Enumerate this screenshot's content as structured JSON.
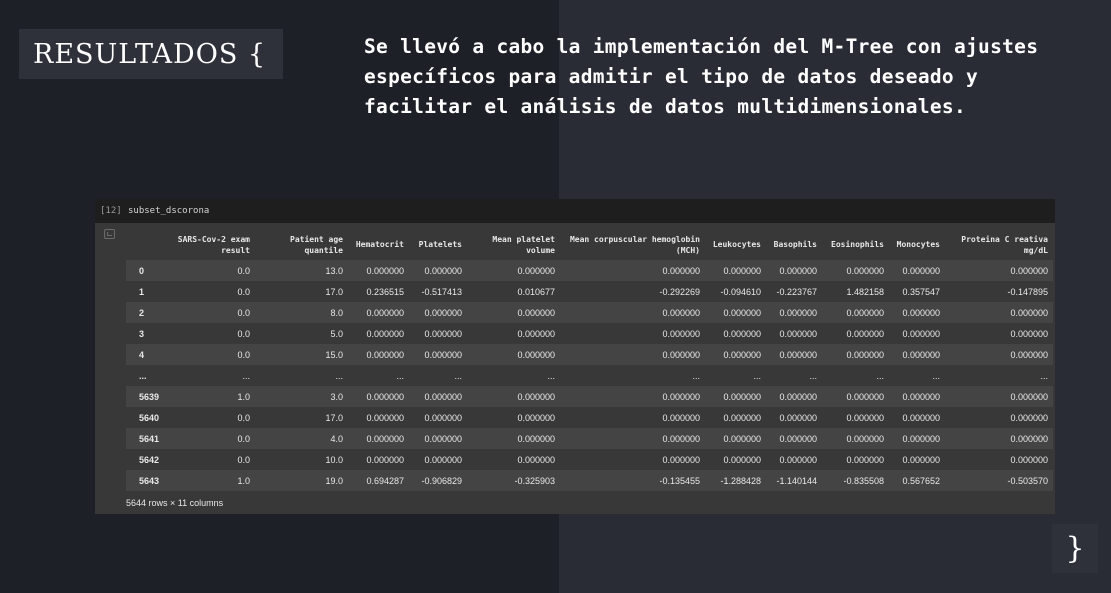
{
  "slide": {
    "title": "RESULTADOS {",
    "description": "Se llevó a cabo la implementación del M-Tree con ajustes específicos para admitir el tipo de datos deseado y facilitar el análisis de datos multidimensionales.",
    "closing_brace": "}"
  },
  "notebook": {
    "execution_count": "[12]",
    "code": "subset_dscorona",
    "columns": [
      "",
      "SARS-Cov-2 exam result",
      "Patient age quantile",
      "Hematocrit",
      "Platelets",
      "Mean platelet volume",
      "Mean corpuscular hemoglobin (MCH)",
      "Leukocytes",
      "Basophils",
      "Eosinophils",
      "Monocytes",
      "Proteina C reativa mg/dL"
    ],
    "rows": [
      [
        "0",
        "0.0",
        "13.0",
        "0.000000",
        "0.000000",
        "0.000000",
        "0.000000",
        "0.000000",
        "0.000000",
        "0.000000",
        "0.000000",
        "0.000000"
      ],
      [
        "1",
        "0.0",
        "17.0",
        "0.236515",
        "-0.517413",
        "0.010677",
        "-0.292269",
        "-0.094610",
        "-0.223767",
        "1.482158",
        "0.357547",
        "-0.147895"
      ],
      [
        "2",
        "0.0",
        "8.0",
        "0.000000",
        "0.000000",
        "0.000000",
        "0.000000",
        "0.000000",
        "0.000000",
        "0.000000",
        "0.000000",
        "0.000000"
      ],
      [
        "3",
        "0.0",
        "5.0",
        "0.000000",
        "0.000000",
        "0.000000",
        "0.000000",
        "0.000000",
        "0.000000",
        "0.000000",
        "0.000000",
        "0.000000"
      ],
      [
        "4",
        "0.0",
        "15.0",
        "0.000000",
        "0.000000",
        "0.000000",
        "0.000000",
        "0.000000",
        "0.000000",
        "0.000000",
        "0.000000",
        "0.000000"
      ],
      [
        "...",
        "...",
        "...",
        "...",
        "...",
        "...",
        "...",
        "...",
        "...",
        "...",
        "...",
        "..."
      ],
      [
        "5639",
        "1.0",
        "3.0",
        "0.000000",
        "0.000000",
        "0.000000",
        "0.000000",
        "0.000000",
        "0.000000",
        "0.000000",
        "0.000000",
        "0.000000"
      ],
      [
        "5640",
        "0.0",
        "17.0",
        "0.000000",
        "0.000000",
        "0.000000",
        "0.000000",
        "0.000000",
        "0.000000",
        "0.000000",
        "0.000000",
        "0.000000"
      ],
      [
        "5641",
        "0.0",
        "4.0",
        "0.000000",
        "0.000000",
        "0.000000",
        "0.000000",
        "0.000000",
        "0.000000",
        "0.000000",
        "0.000000",
        "0.000000"
      ],
      [
        "5642",
        "0.0",
        "10.0",
        "0.000000",
        "0.000000",
        "0.000000",
        "0.000000",
        "0.000000",
        "0.000000",
        "0.000000",
        "0.000000",
        "0.000000"
      ],
      [
        "5643",
        "1.0",
        "19.0",
        "0.694287",
        "-0.906829",
        "-0.325903",
        "-0.135455",
        "-1.288428",
        "-1.140144",
        "-0.835508",
        "0.567652",
        "-0.503570"
      ]
    ],
    "footer": "5644 rows × 11 columns"
  }
}
